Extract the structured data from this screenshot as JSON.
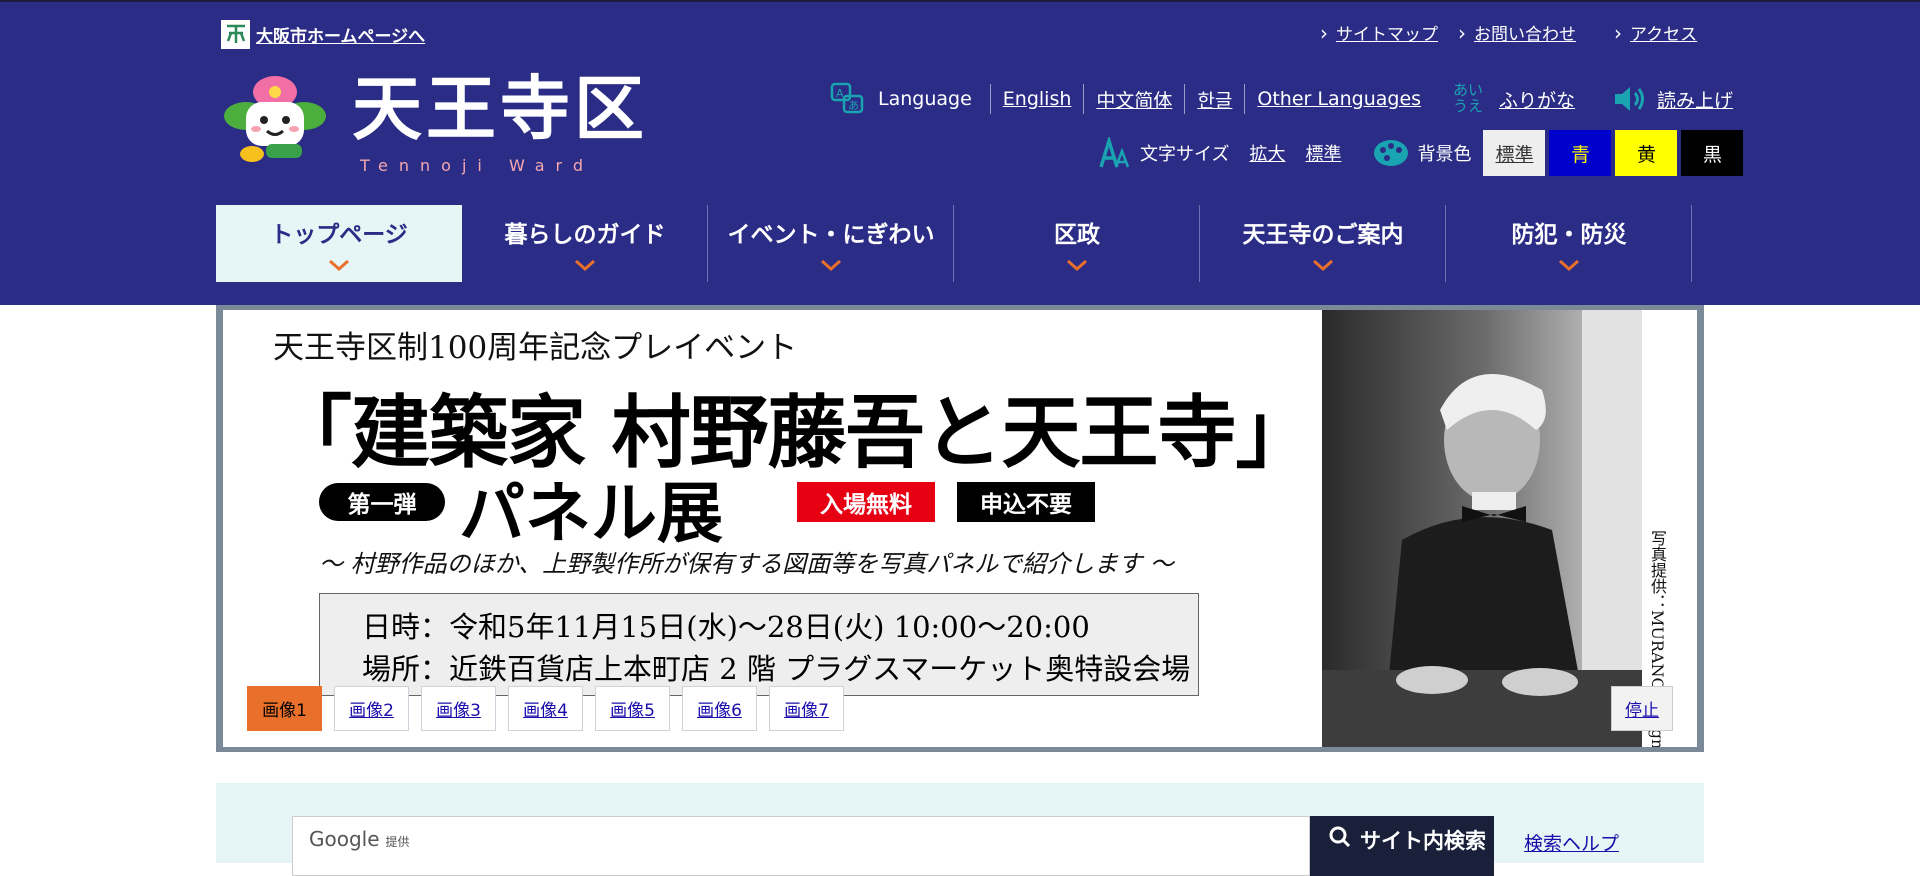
{
  "header": {
    "city_link": "大阪市ホームページへ",
    "util_links": [
      "サイトマップ",
      "お問い合わせ",
      "アクセス"
    ],
    "ward_name": "天王寺区",
    "ward_name_en": "Tennoji Ward",
    "language_label": "Language",
    "languages": [
      "English",
      "中文简体",
      "한글",
      "Other Languages"
    ],
    "furigana_icon_text": "あい うえ",
    "furigana": "ふりがな",
    "read_aloud": "読み上げ",
    "text_size_label": "文字サイズ",
    "text_size_options": [
      "拡大",
      "標準"
    ],
    "bg_color_label": "背景色",
    "bg_options": [
      {
        "label": "標準",
        "bg": "#eeeeee",
        "fg": "#333333"
      },
      {
        "label": "青",
        "bg": "#0000cc",
        "fg": "#ffff00"
      },
      {
        "label": "黄",
        "bg": "#ffff00",
        "fg": "#000000"
      },
      {
        "label": "黒",
        "bg": "#000000",
        "fg": "#ffffff"
      }
    ]
  },
  "nav": {
    "items": [
      "トップページ",
      "暮らしのガイド",
      "イベント・にぎわい",
      "区政",
      "天王寺のご案内",
      "防犯・防災"
    ],
    "active_index": 0
  },
  "slider": {
    "title1": "天王寺区制100周年記念プレイベント",
    "title2": "「建築家 村野藤吾と天王寺」",
    "badge": "第一弾",
    "panel": "パネル展",
    "free": "入場無料",
    "no_application": "申込不要",
    "subtitle": "～ 村野作品のほか、上野製作所が保有する図面等を写真パネルで紹介します ～",
    "datetime": "日時：令和5年11月15日(水)～28日(火) 10:00～20:00",
    "place": "場所：近鉄百貨店上本町店 2 階 プラグスマーケット奥特設会場",
    "photo_credit": "写真提供：MURANO design",
    "thumbs": [
      "画像1",
      "画像2",
      "画像3",
      "画像4",
      "画像5",
      "画像6",
      "画像7"
    ],
    "active_thumb": 0,
    "stop": "停止"
  },
  "search": {
    "google_label": "Google",
    "google_sub": "提供",
    "button": "サイト内検索",
    "help": "検索ヘルプ"
  },
  "colors": {
    "header_bg": "#2b2c86",
    "accent_orange": "#e8702a",
    "teal_icons": "#1aa3b0",
    "nav_active_bg": "#e6f5f5"
  }
}
